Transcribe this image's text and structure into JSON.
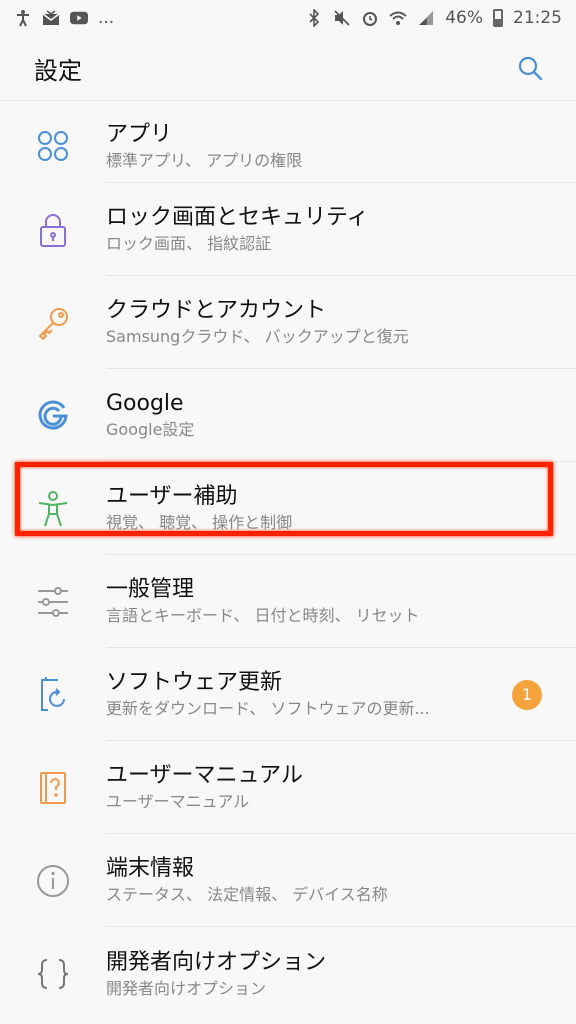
{
  "status_bar": {
    "battery": "46%",
    "time": "21:25",
    "more": "..."
  },
  "header": {
    "title": "設定"
  },
  "items": [
    {
      "title": "アプリ",
      "subtitle": "標準アプリ、 アプリの権限",
      "icon": "apps-grid-icon",
      "color": "#4a90d9"
    },
    {
      "title": "ロック画面とセキュリティ",
      "subtitle": "ロック画面、 指紋認証",
      "icon": "lock-icon",
      "color": "#8a6fd6"
    },
    {
      "title": "クラウドとアカウント",
      "subtitle": "Samsungクラウド、 バックアップと復元",
      "icon": "key-icon",
      "color": "#f39a4a"
    },
    {
      "title": "Google",
      "subtitle": "Google設定",
      "icon": "google-icon",
      "color": "#4a90d9"
    },
    {
      "title": "ユーザー補助",
      "subtitle": "視覚、 聴覚、 操作と制御",
      "icon": "accessibility-icon",
      "color": "#4fb361"
    },
    {
      "title": "一般管理",
      "subtitle": "言語とキーボード、 日付と時刻、 リセット",
      "icon": "sliders-icon",
      "color": "#999999"
    },
    {
      "title": "ソフトウェア更新",
      "subtitle": "更新をダウンロード、 ソフトウェアの更新...",
      "icon": "software-update-icon",
      "color": "#4a90d9",
      "badge": "1"
    },
    {
      "title": "ユーザーマニュアル",
      "subtitle": "ユーザーマニュアル",
      "icon": "manual-icon",
      "color": "#f39a4a"
    },
    {
      "title": "端末情報",
      "subtitle": "ステータス、 法定情報、 デバイス名称",
      "icon": "info-icon",
      "color": "#999999"
    },
    {
      "title": "開発者向けオプション",
      "subtitle": "開発者向けオプション",
      "icon": "developer-braces-icon",
      "color": "#777777"
    }
  ],
  "colors": {
    "highlight": "#ff2200",
    "badge": "#f4a23b"
  }
}
